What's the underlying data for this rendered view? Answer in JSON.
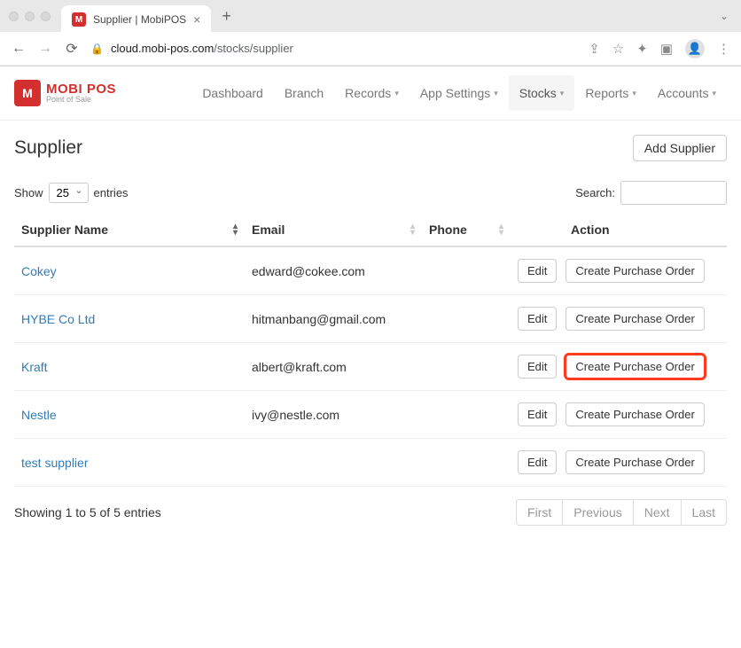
{
  "browser": {
    "tab_title": "Supplier | MobiPOS",
    "url_domain": "cloud.mobi-pos.com",
    "url_path": "/stocks/supplier"
  },
  "brand": {
    "name": "MOBI POS",
    "tagline": "Point of Sale",
    "logo_letter": "M"
  },
  "nav": {
    "items": [
      {
        "label": "Dashboard",
        "dropdown": false
      },
      {
        "label": "Branch",
        "dropdown": false
      },
      {
        "label": "Records",
        "dropdown": true
      },
      {
        "label": "App Settings",
        "dropdown": true
      },
      {
        "label": "Stocks",
        "dropdown": true,
        "active": true
      },
      {
        "label": "Reports",
        "dropdown": true
      },
      {
        "label": "Accounts",
        "dropdown": true
      }
    ]
  },
  "page": {
    "title": "Supplier",
    "add_button": "Add Supplier"
  },
  "table": {
    "show_label": "Show",
    "entries_label": "entries",
    "page_size": "25",
    "search_label": "Search:",
    "columns": {
      "name": "Supplier Name",
      "email": "Email",
      "phone": "Phone",
      "action": "Action"
    },
    "rows": [
      {
        "name": "Cokey",
        "email": "edward@cokee.com",
        "phone": "",
        "highlighted": false
      },
      {
        "name": "HYBE Co Ltd",
        "email": "hitmanbang@gmail.com",
        "phone": "",
        "highlighted": false
      },
      {
        "name": "Kraft",
        "email": "albert@kraft.com",
        "phone": "",
        "highlighted": true
      },
      {
        "name": "Nestle",
        "email": "ivy@nestle.com",
        "phone": "",
        "highlighted": false
      },
      {
        "name": "test supplier",
        "email": "",
        "phone": "",
        "highlighted": false
      }
    ],
    "edit_label": "Edit",
    "create_po_label": "Create Purchase Order",
    "info": "Showing 1 to 5 of 5 entries",
    "pagination": {
      "first": "First",
      "prev": "Previous",
      "next": "Next",
      "last": "Last"
    }
  }
}
